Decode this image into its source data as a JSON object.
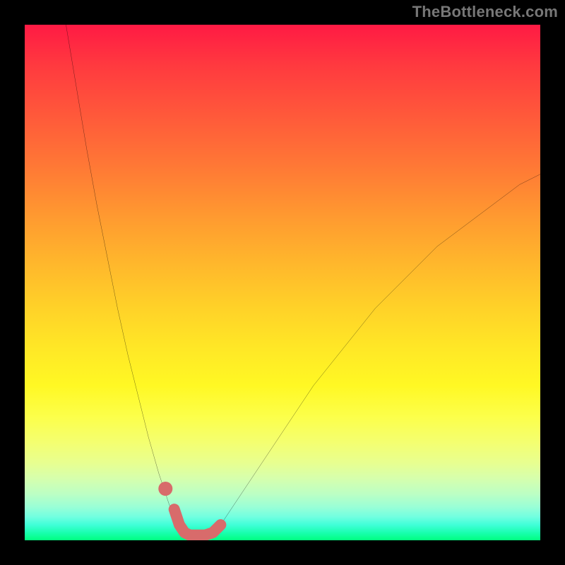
{
  "watermark": "TheBottleneck.com",
  "chart_data": {
    "type": "line",
    "title": "",
    "xlabel": "",
    "ylabel": "",
    "xlim": [
      0,
      100
    ],
    "ylim": [
      0,
      100
    ],
    "legend": false,
    "grid": false,
    "series": [
      {
        "name": "left-branch",
        "x": [
          8,
          10,
          12,
          14,
          16,
          18,
          20,
          22,
          24,
          26,
          28,
          29.5
        ],
        "values": [
          100,
          88,
          76,
          65,
          55,
          45,
          36,
          28,
          20,
          13,
          7,
          3
        ],
        "color": "#000000",
        "stroke_width": 2
      },
      {
        "name": "right-branch",
        "x": [
          38,
          40,
          44,
          48,
          52,
          56,
          60,
          64,
          68,
          72,
          76,
          80,
          84,
          88,
          92,
          96,
          100
        ],
        "values": [
          3,
          6,
          12,
          18,
          24,
          30,
          35,
          40,
          45,
          49,
          53,
          57,
          60,
          63,
          66,
          69,
          71
        ],
        "color": "#000000",
        "stroke_width": 2
      },
      {
        "name": "bottom-pink-segment",
        "x": [
          29,
          30,
          31,
          32,
          33.5,
          35,
          36.5,
          38
        ],
        "values": [
          6,
          3,
          1.5,
          1,
          1,
          1,
          1.5,
          3
        ],
        "color": "#d86b6b",
        "stroke_width": 16,
        "round_caps": true
      },
      {
        "name": "pink-dot",
        "x": [
          27.3
        ],
        "values": [
          10
        ],
        "color": "#d86b6b",
        "marker": "circle",
        "marker_size": 10
      }
    ],
    "background_gradient": {
      "direction": "vertical",
      "stops": [
        {
          "pos": 0,
          "color": "#ff1a44"
        },
        {
          "pos": 0.55,
          "color": "#ffd228"
        },
        {
          "pos": 0.75,
          "color": "#fcff4a"
        },
        {
          "pos": 1,
          "color": "#00ff80"
        }
      ]
    }
  }
}
